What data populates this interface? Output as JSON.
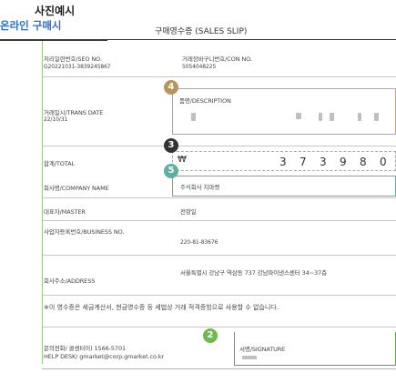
{
  "header": {
    "badge_line1": "사진예시",
    "badge_line2": "온라인 구매시",
    "title": "구매영수증 (SALES SLIP)"
  },
  "fields": {
    "seo_label": "처리일련번호/SEO NO.",
    "seo_value": "G20221031-3839245867",
    "con_label": "거래장바구니번호/CON NO.",
    "con_value": "5054048225",
    "trans_date_label": "거래일시/TRANS DATE",
    "trans_date_value": "22/10/31",
    "description_label": "품명/DESCRIPTION",
    "total_label": "합계/TOTAL",
    "total_currency": "₩",
    "total_digits": [
      "3",
      "7",
      "3",
      "9",
      "8",
      "0"
    ],
    "company_label": "회사명/COMPANY NAME",
    "company_value": "주식회사 지마켓",
    "master_label": "대표자/MASTER",
    "master_value": "전항일",
    "business_label": "사업자등록번호/BUSINESS NO.",
    "business_value": "220-81-83676",
    "address_label": "회사주소/ADDRESS",
    "address_value": "서울특별시 강남구 역삼동 737 강남파이낸스센터 34~37층",
    "notice": "※이 영수증은 세금계산서, 현금영수증 등 세법상 거래 적격증빙으로 사용할 수 없습니다.",
    "help_line1": "문의전화/ 콜센터이) 1566-5701",
    "help_line2": "HELP DESK/ gmarket@corp.gmarket.co.kr",
    "signature_label": "서명/SIGNATURE"
  },
  "badges": {
    "b2": "2",
    "b3": "3",
    "b4": "4",
    "b5": "5"
  },
  "colors": {
    "accent_green": "#5aa83a",
    "badge_gold": "#b8955a",
    "badge_dark": "#333333",
    "badge_teal": "#5fb0a0",
    "badge_green": "#6fb84a"
  }
}
